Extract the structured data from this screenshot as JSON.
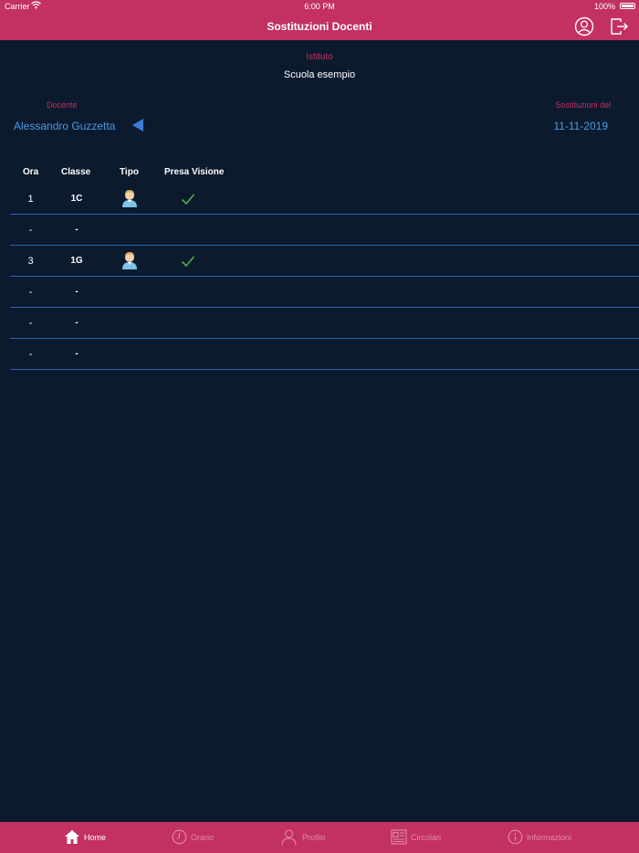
{
  "status_bar": {
    "carrier": "Carrier",
    "time": "6:00 PM",
    "battery": "100%"
  },
  "nav": {
    "title": "Sostituzioni Docenti",
    "profile_icon": "user-circle-icon",
    "logout_icon": "logout-icon"
  },
  "istituto": {
    "label": "Istituto",
    "value": "Scuola esempio"
  },
  "docente": {
    "label": "Docente",
    "value": "Alessandro Guzzetta"
  },
  "date": {
    "label": "Sostituzioni del",
    "value": "11-11-2019"
  },
  "table": {
    "headers": {
      "ora": "Ora",
      "classe": "Classe",
      "tipo": "Tipo",
      "visione": "Presa Visione"
    },
    "rows": [
      {
        "ora": "1",
        "classe": "1C",
        "tipo": "teacher-icon",
        "visione": true
      },
      {
        "ora": "-",
        "classe": "-",
        "tipo": "",
        "visione": false
      },
      {
        "ora": "3",
        "classe": "1G",
        "tipo": "teacher-icon",
        "visione": true
      },
      {
        "ora": "-",
        "classe": "-",
        "tipo": "",
        "visione": false
      },
      {
        "ora": "-",
        "classe": "-",
        "tipo": "",
        "visione": false
      },
      {
        "ora": "-",
        "classe": "-",
        "tipo": "",
        "visione": false
      }
    ]
  },
  "tabs": [
    {
      "label": "Home",
      "icon": "home-icon",
      "active": true
    },
    {
      "label": "Orario",
      "icon": "clock-icon",
      "active": false
    },
    {
      "label": "Profilo",
      "icon": "user-icon",
      "active": false
    },
    {
      "label": "Circolari",
      "icon": "newspaper-icon",
      "active": false
    },
    {
      "label": "Informazioni",
      "icon": "info-icon",
      "active": false
    }
  ],
  "colors": {
    "accent": "#c23162",
    "background": "#0c1a2e",
    "link": "#4a9be3",
    "check": "#4caf50",
    "divider": "#2d63a8"
  }
}
